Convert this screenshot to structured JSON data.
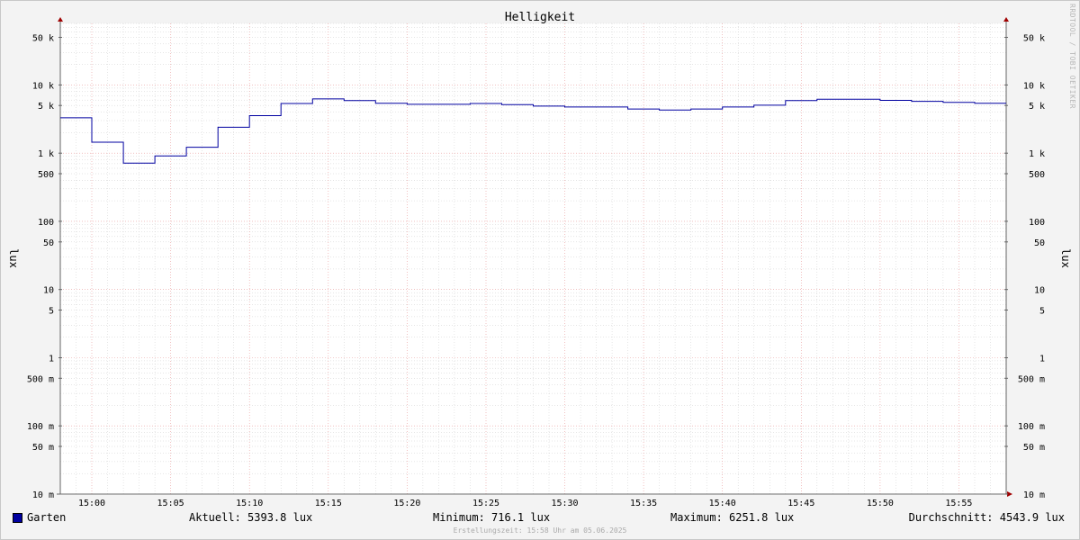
{
  "chart_data": {
    "type": "line",
    "title": "Helligkeit",
    "ylabel": "lux",
    "y_scale": "log",
    "ylim": [
      0.01,
      80000
    ],
    "grid": true,
    "legend_placement": "bottom-left",
    "x_range": [
      "14:58",
      "15:58"
    ],
    "x_ticks": [
      "15:00",
      "15:05",
      "15:10",
      "15:15",
      "15:20",
      "15:25",
      "15:30",
      "15:35",
      "15:40",
      "15:45",
      "15:50",
      "15:55"
    ],
    "y_ticks": [
      {
        "value": 0.01,
        "label": "10 m"
      },
      {
        "value": 0.05,
        "label": "50 m"
      },
      {
        "value": 0.1,
        "label": "100 m"
      },
      {
        "value": 0.5,
        "label": "500 m"
      },
      {
        "value": 1,
        "label": "1"
      },
      {
        "value": 5,
        "label": "5"
      },
      {
        "value": 10,
        "label": "10"
      },
      {
        "value": 50,
        "label": "50"
      },
      {
        "value": 100,
        "label": "100"
      },
      {
        "value": 500,
        "label": "500"
      },
      {
        "value": 1000,
        "label": "1 k"
      },
      {
        "value": 5000,
        "label": "5 k"
      },
      {
        "value": 10000,
        "label": "10 k"
      },
      {
        "value": 50000,
        "label": "50 k"
      }
    ],
    "series": [
      {
        "name": "Garten",
        "color": "#0000a0",
        "step": true,
        "points": [
          [
            "14:58",
            3300
          ],
          [
            "15:00",
            1450
          ],
          [
            "15:02",
            716.1
          ],
          [
            "15:04",
            910
          ],
          [
            "15:06",
            1220
          ],
          [
            "15:08",
            2400
          ],
          [
            "15:10",
            3550
          ],
          [
            "15:12",
            5350
          ],
          [
            "15:14",
            6251.8
          ],
          [
            "15:16",
            5900
          ],
          [
            "15:18",
            5400
          ],
          [
            "15:20",
            5200
          ],
          [
            "15:24",
            5350
          ],
          [
            "15:26",
            5150
          ],
          [
            "15:28",
            4900
          ],
          [
            "15:30",
            4750
          ],
          [
            "15:34",
            4450
          ],
          [
            "15:36",
            4300
          ],
          [
            "15:38",
            4450
          ],
          [
            "15:40",
            4750
          ],
          [
            "15:42",
            5050
          ],
          [
            "15:44",
            5900
          ],
          [
            "15:46",
            6200
          ],
          [
            "15:50",
            5950
          ],
          [
            "15:52",
            5750
          ],
          [
            "15:54",
            5550
          ],
          [
            "15:56",
            5393.8
          ],
          [
            "15:58",
            5393.8
          ]
        ]
      }
    ]
  },
  "legend": {
    "series_name": "Garten",
    "current": "Aktuell: 5393.8 lux",
    "minimum": "Minimum: 716.1 lux",
    "maximum": "Maximum: 6251.8 lux",
    "average": "Durchschnitt: 4543.9 lux"
  },
  "footer": {
    "created": "Erstellungszeit: 15:58 Uhr am 05.06.2025"
  },
  "watermark": "RRDTOOL / TOBI OETIKER"
}
